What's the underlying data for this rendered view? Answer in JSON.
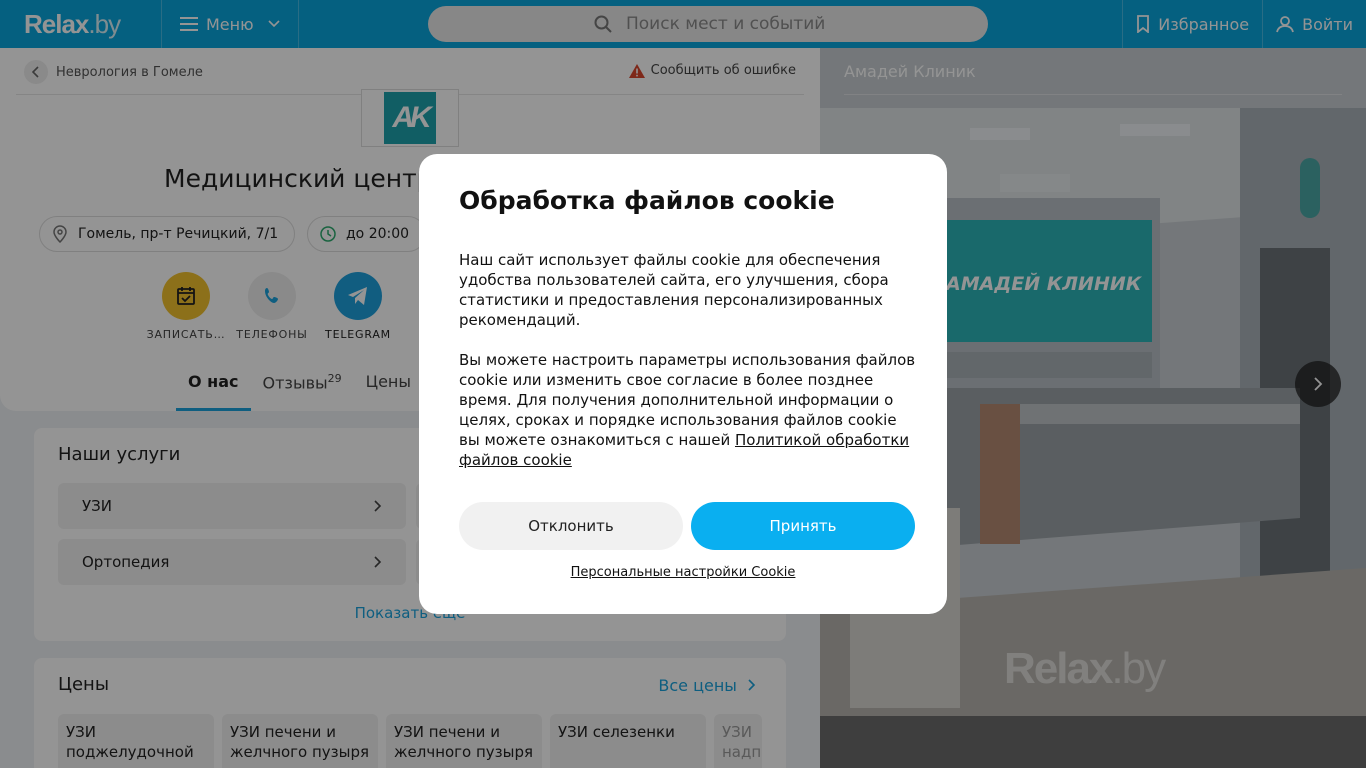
{
  "header": {
    "logo": "Relax",
    "logo_suffix": ".by",
    "menu_label": "Меню",
    "search_placeholder": "Поиск мест и событий",
    "favorites_label": "Избранное",
    "login_label": "Войти",
    "brand_color": "#0aa6dc"
  },
  "page": {
    "breadcrumb": "Неврология в Гомеле",
    "report_error": "Сообщить об ошибке",
    "logo_text": "AK",
    "title": "Медицинский центр",
    "address": "Гомель, пр-т Речицкий, 7/1",
    "hours": "до 20:00",
    "actions": [
      {
        "label": "ЗАПИСАТЬ…",
        "icon": "calendar-check-icon",
        "color": "#f2c12e"
      },
      {
        "label": "ТЕЛЕФОНЫ",
        "icon": "phone-icon",
        "color": "#eeeeee"
      },
      {
        "label": "TELEGRAM",
        "icon": "telegram-icon",
        "color": "#1ea0dd"
      }
    ],
    "tabs": [
      {
        "label": "О нас",
        "active": true
      },
      {
        "label": "Отзывы",
        "count": "29"
      },
      {
        "label": "Цены"
      }
    ],
    "services": {
      "heading": "Наши услуги",
      "items": [
        "УЗИ",
        "Ортопедия"
      ],
      "show_more": "Показать еще"
    },
    "prices": {
      "heading": "Цены",
      "all_prices": "Все цены",
      "tiles": [
        "УЗИ поджелудочной",
        "УЗИ печени и желчного пузыря",
        "УЗИ печени и желчного пузыря",
        "УЗИ селезенки",
        "УЗИ надп"
      ]
    }
  },
  "photo": {
    "name": "Амадей Клиник",
    "watermark": "Relax",
    "watermark_suffix": ".by",
    "sign_text": "АМАДЕЙ КЛИНИК"
  },
  "cookie_modal": {
    "title": "Обработка файлов cookie",
    "paragraph1": "Наш сайт использует файлы cookie для обеспечения удобства пользователей сайта, его улучшения, сбора статистики и предоставления персонализированных рекомендаций.",
    "paragraph2": "Вы можете настроить параметры использования файлов cookie или изменить свое согласие в более позднее время. Для получения дополнительной информации о целях, сроках и порядке использования файлов cookie вы можете ознакомиться с нашей ",
    "policy_link": "Политикой обработки файлов cookie",
    "decline_label": "Отклонить",
    "accept_label": "Принять",
    "personal_settings": "Персональные настройки Cookie",
    "accept_color": "#0aaff0"
  }
}
